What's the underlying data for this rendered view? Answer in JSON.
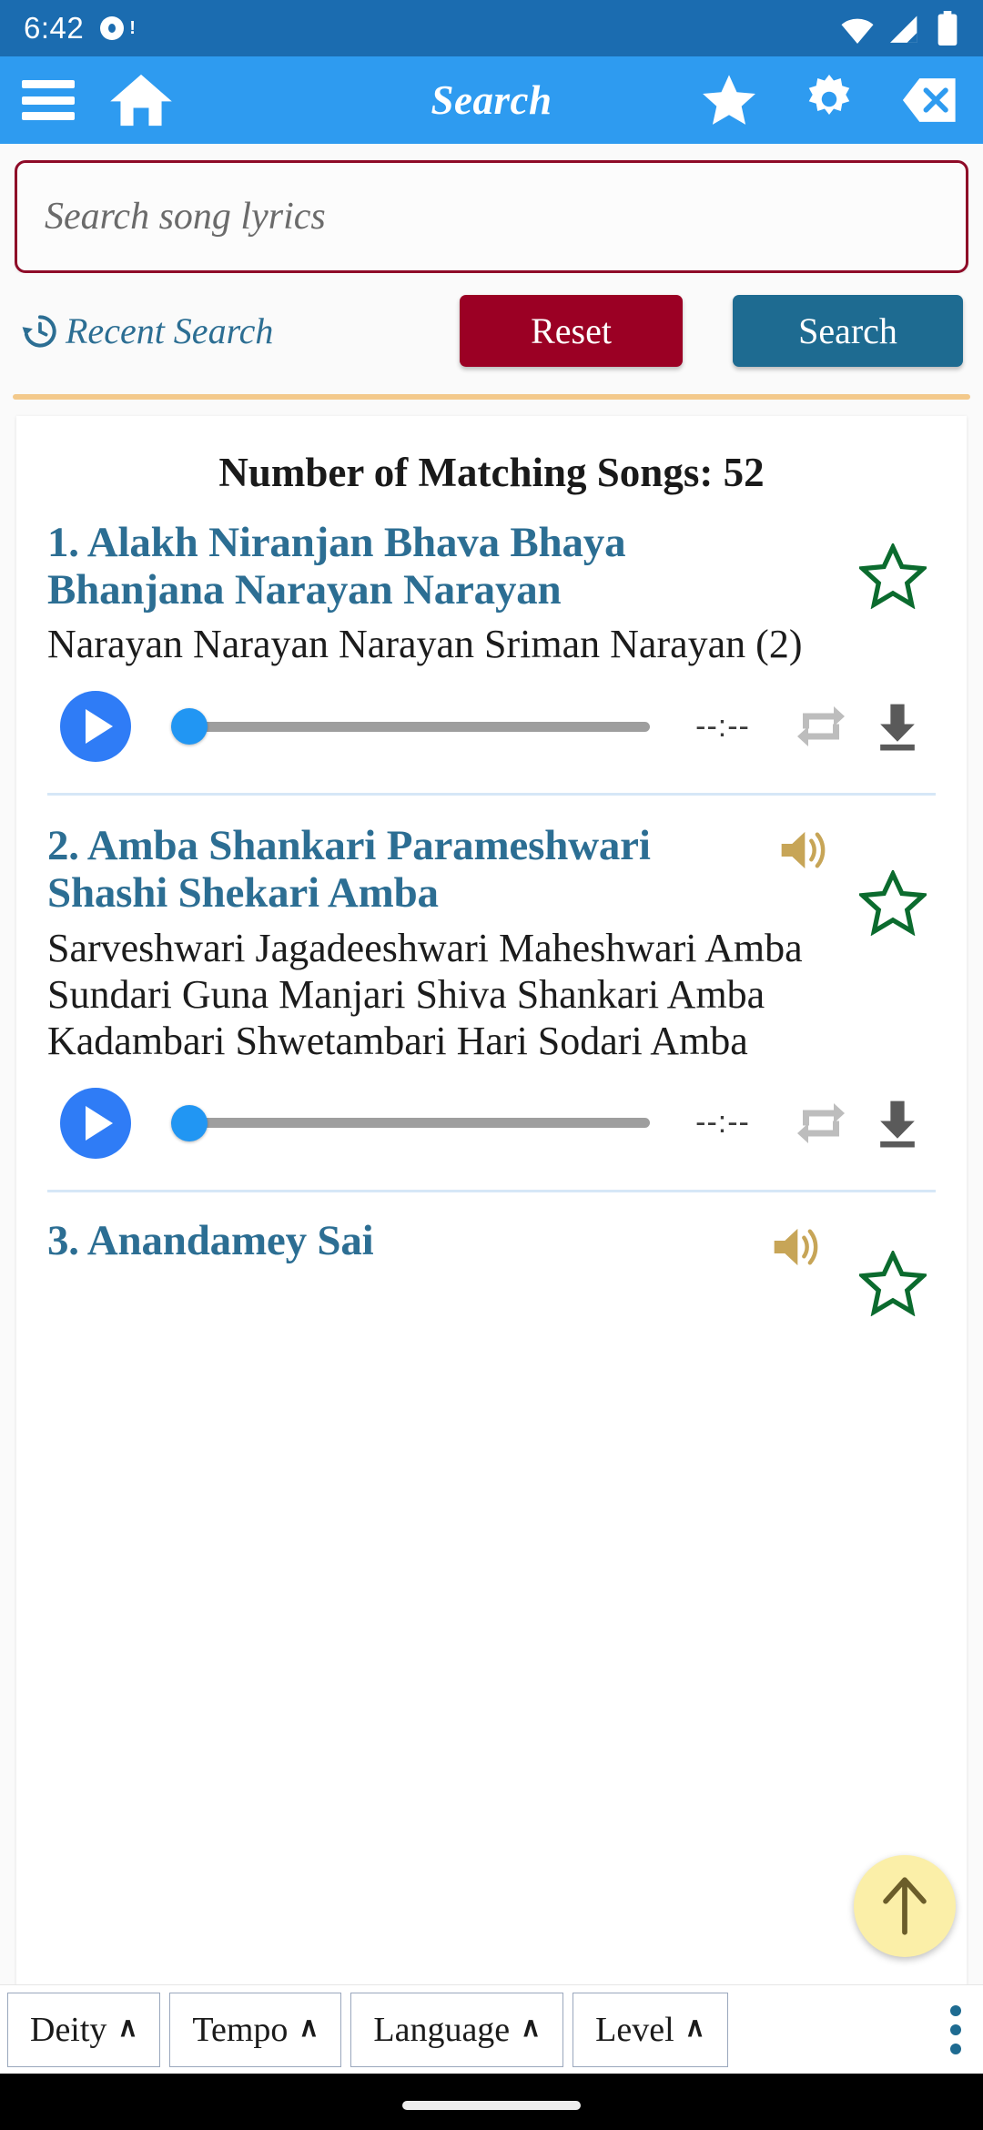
{
  "status_bar": {
    "time": "6:42",
    "icons": [
      "notification-dot-icon",
      "wifi-icon",
      "cell-signal-icon",
      "battery-icon"
    ]
  },
  "app_bar": {
    "title": "Search",
    "left_icons": [
      "hamburger-menu-icon",
      "home-icon"
    ],
    "right_icons": [
      "favorites-star-icon",
      "settings-gear-icon",
      "clear-backspace-icon"
    ]
  },
  "search": {
    "value": "",
    "placeholder": "Search song lyrics"
  },
  "actions": {
    "recent_search_label": "Recent Search",
    "recent_search_icon": "history-icon",
    "reset_label": "Reset",
    "reset_color": "#9B0024",
    "search_label": "Search",
    "search_color": "#1E6B91"
  },
  "results": {
    "count_label": "Number of Matching Songs: 52",
    "songs": [
      {
        "title": "1. Alakh Niranjan Bhava Bhaya Bhanjana Narayan Narayan",
        "lyrics": "Narayan Narayan Narayan Sriman Narayan (2)",
        "has_speaker": false,
        "starred": false,
        "player": {
          "play_icon": "play-icon",
          "progress": 0,
          "time": "--:--",
          "repeat_icon": "repeat-icon",
          "download_icon": "download-icon"
        }
      },
      {
        "title": "2. Amba Shankari Parameshwari Shashi Shekari Amba",
        "lyrics": "Sarveshwari Jagadeeshwari Maheshwari Amba\nSundari Guna Manjari Shiva Shankari Amba\nKadambari Shwetambari Hari Sodari Amba",
        "has_speaker": true,
        "starred": false,
        "player": {
          "play_icon": "play-icon",
          "progress": 0,
          "time": "--:--",
          "repeat_icon": "repeat-icon",
          "download_icon": "download-icon"
        }
      },
      {
        "title": "3. Anandamey Sai",
        "lyrics": "",
        "has_speaker": true,
        "starred": false
      }
    ]
  },
  "fab": {
    "icon": "arrow-up-icon",
    "color": "#FBEFA8"
  },
  "bottom_bar": {
    "filters": [
      {
        "label": "Deity",
        "caret": "∧"
      },
      {
        "label": "Tempo",
        "caret": "∧"
      },
      {
        "label": "Language",
        "caret": "∧"
      },
      {
        "label": "Level",
        "caret": "∧"
      }
    ],
    "overflow_icon": "more-vertical-icon"
  },
  "colors": {
    "status_bar": "#1B6CB0",
    "app_bar": "#2E9BF0",
    "song_title": "#2C6E93",
    "star_outline": "#0B6B2E",
    "speaker": "#C7A557",
    "search_border": "#8E0B28",
    "tan_divider": "#F3C98B",
    "song_divider": "#D6E7F7"
  }
}
